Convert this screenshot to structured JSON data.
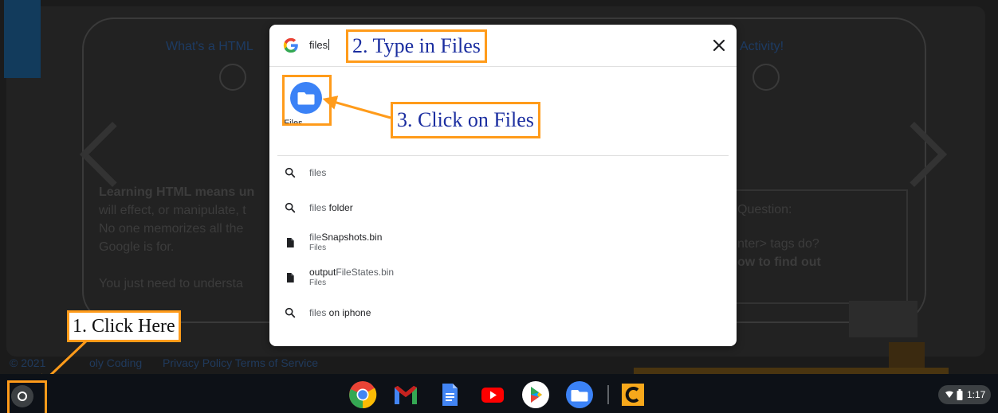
{
  "background_page": {
    "tabs": [
      "What's a HTML",
      "Activity!"
    ],
    "paragraph_1": [
      "Learning HTML means un",
      "will effect, or manipulate, t",
      "No one memorizes all the",
      "Google is for."
    ],
    "paragraph_2": "You just need to understa",
    "right_lines": [
      "Question:",
      "nter> tags do?",
      "ow to find out"
    ],
    "footer_copyright": "© 2021",
    "footer_brand": "oly Coding",
    "footer_links": "Privacy Policy  Terms of Service"
  },
  "launcher": {
    "search_value": "files",
    "app_label": "Files",
    "results": [
      {
        "title_hl": "",
        "title": "files",
        "sub": ""
      },
      {
        "title_hl": "files",
        "title": " folder",
        "sub": ""
      },
      {
        "title_hl": "file",
        "title": "Snapshots.bin",
        "sub": "Files"
      },
      {
        "title_hl": "output",
        "title": "FileStates.bin",
        "sub": "Files"
      },
      {
        "title_hl": "files",
        "title": " on iphone",
        "sub": ""
      }
    ]
  },
  "annotations": {
    "step1": "1. Click Here",
    "step2": "2. Type in Files",
    "step3": "3. Click on Files",
    "accent_color": "#ff9b1a"
  },
  "shelf": {
    "apps": [
      "chrome-icon",
      "gmail-icon",
      "docs-icon",
      "youtube-icon",
      "play-store-icon",
      "files-icon",
      "codesters-icon"
    ],
    "time": "1:17"
  }
}
